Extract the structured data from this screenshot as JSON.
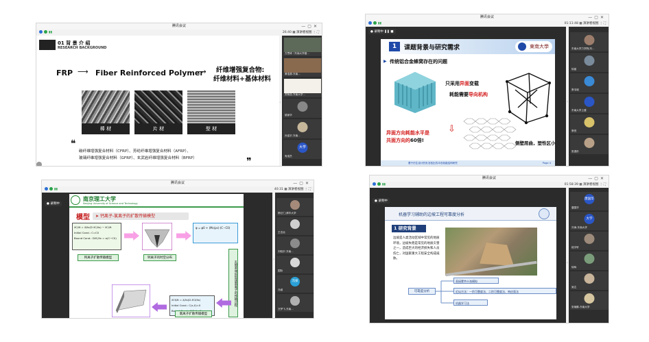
{
  "app_title": "腾讯会议",
  "view_label": "演讲者视图",
  "recording_label": "录制中",
  "times": {
    "w1": "26:40",
    "w2": "01:11:48",
    "w3": "40:31",
    "w4": "01:58:39"
  },
  "w1": {
    "heading": "01 背 景 介 绍",
    "subheading": "RESEARCH BACKGROUND",
    "frp": "FRP",
    "fiber": "Fiber Reinforced Polymer",
    "composite_line1": "纤维增强复合物:",
    "composite_line2": "纤维材料+基体材料",
    "img_labels": [
      "棒 材",
      "片 材",
      "型 材"
    ],
    "quote_l": "❝",
    "quote_r": "❞",
    "desc1": "碳纤维增强复合材料（CFRP）、芳纶纤维增强复合材料（AFRP）、",
    "desc2": "玻璃纤维增强复合材料（GFRP）、玄武岩纤维增强复合材料（BFRP）",
    "participants": [
      "万思琦（东南大学建...",
      "黄浩源-东南...",
      "宾杨浩-东南大学...",
      "姚家华",
      "孙金宇-东南...",
      "大学",
      "有成员"
    ]
  },
  "w2": {
    "num": "1",
    "title": "课题背景与研究需求",
    "logo_text": "東南大學",
    "bullet": "传统铝合金蜂窝存在的问题",
    "label_a": "只采用",
    "label_a2": "异面",
    "label_a3": "变载",
    "label_b": "耗能需要",
    "label_b2": "导向机构",
    "red1": "异面方向耗能水平是",
    "red2": "共面方向的",
    "red2b": "60倍!",
    "bottom_right": "侧壁屈曲，塑性区小",
    "footer": "基于仿生设计的负泊松比抗冲击吸能结构研究",
    "page": "Page 4",
    "participants": [
      "东南大学力学院(刘...",
      "徐曾",
      "蔡韦城",
      "东南大学土建",
      "蔡悦",
      "张逸彤"
    ]
  },
  "w3": {
    "school": "南京理工大学",
    "school_en": "Nanjing University of Science and Technology",
    "model": "模型",
    "model_sub": "钙离子-氯离子的扩散传输模型",
    "box1_label": "钙离子扩散传输模型",
    "box2_label": "钙离子的时空分布",
    "box3_label": "氯离子扩散传输模型",
    "vertical": "孔隙率增加加速氯离子的传输过程",
    "eq1": "∂C/∂t = ∂/∂x(D ∂C/∂x) − ∂C/∂t",
    "eq1b": "Initial Cond.: C=C0",
    "eq1c": "Bound Cond.: D∂C/∂x = α(C−C0)",
    "eq3": "∂Cf/∂t = ∂/∂x(D ∂Cf/∂x)",
    "eq3b": "Initial Cond.: C(x,0)=0",
    "eq3c": "Bound Cond.: C(0,t)=Cs",
    "eq2": "φ = φ0 + (Mc/ρc)·(C−C0)",
    "participants": [
      "杨亿仁(清华大学",
      "王志远",
      "刘晓宇-东南...",
      "国际",
      "冯泉",
      "冯维",
      "万梦飞-东南..."
    ]
  },
  "w4": {
    "title": "机器学习辅助的边坡工程可靠度分析",
    "section_num": "1",
    "section": "研究背景",
    "para": "边坡是人类活动区域中常见的地质环境，边坡失稳是常见的地质灾害之一，造成巨大的经济损失和人员伤亡，对国家重大工程安全构成威胁。",
    "center_label": "可靠度分析",
    "branches": [
      "直接蒙特卡洛模拟",
      "近似方法：一阶可靠度法、二阶可靠度法、响应面法",
      "机器学习法"
    ],
    "participants": [
      "唐国华",
      "大学",
      "刘涛-东南大学",
      "段宇轩",
      "徐辉",
      "吴达",
      "张瑜鹏-东南大学"
    ]
  }
}
